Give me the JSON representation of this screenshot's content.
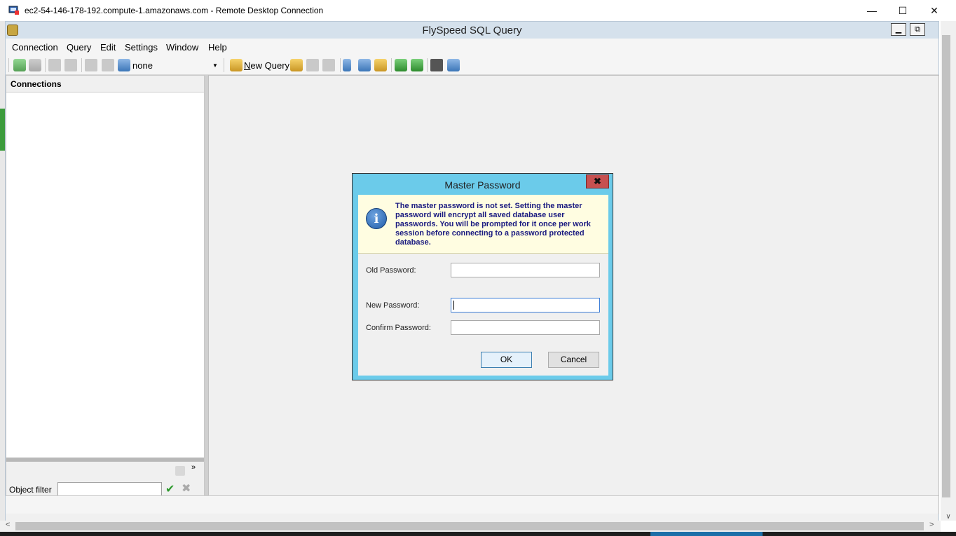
{
  "rdp": {
    "title": "ec2-54-146-178-192.compute-1.amazonaws.com - Remote Desktop Connection",
    "minimize": "—",
    "maximize": "☐",
    "close": "✕"
  },
  "app": {
    "title": "FlySpeed SQL Query",
    "mdi_min": "▁",
    "mdi_restore": "⧉"
  },
  "menu": [
    "Connection",
    "Query",
    "Edit",
    "Settings",
    "Window",
    "Help"
  ],
  "toolbar": {
    "connection_select": "none",
    "new_query_label": "New Query",
    "new_query_underline": "N",
    "new_query_rest": "ew Query"
  },
  "connections_panel": {
    "header": "Connections",
    "object_filter_label": "Object filter",
    "object_filter_value": "",
    "apply_glyph": "✔",
    "clear_glyph": "✖",
    "more_glyph": "»"
  },
  "dialog": {
    "title": "Master Password",
    "close_glyph": "✖",
    "info_glyph": "i",
    "message": "The master password is not set. Setting the master password will encrypt all saved database user passwords. You will be prompted for it once per work session before connecting to a password protected database.",
    "old_password_label": "Old Password:",
    "new_password_label": "New Password:",
    "confirm_password_label": "Confirm Password:",
    "ok_label": "OK",
    "cancel_label": "Cancel"
  },
  "scrollbar": {
    "up": "▲",
    "down": "∨",
    "left": "<",
    "right": ">"
  },
  "colors": {
    "dialog_frame": "#6bcbea",
    "info_background": "#fffde1",
    "info_text": "#1a1a80",
    "close_button": "#c75050"
  }
}
